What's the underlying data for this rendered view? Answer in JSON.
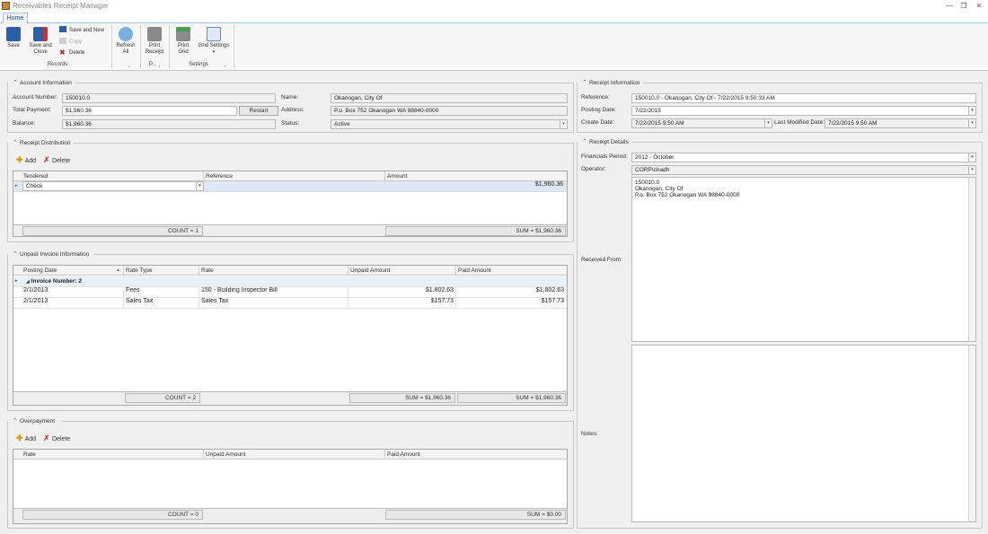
{
  "window": {
    "title": "Receivables Receipt Manager",
    "minimize": "—",
    "restore": "❐",
    "close": "✕"
  },
  "tabs": {
    "home": "Home"
  },
  "ribbon": {
    "save": "Save",
    "save_and_close_1": "Save and",
    "save_and_close_2": "Close",
    "save_and_new": "Save and New",
    "copy": "Copy",
    "delete": "Delete",
    "records_group": "Records",
    "refresh_1": "Refresh",
    "refresh_2": "All",
    "print_receipt_1": "Print",
    "print_receipt_2": "Receipt",
    "print_group": "P...",
    "print_grid_1": "Print",
    "print_grid_2": "Grid",
    "grid_settings": "Grid Settings",
    "settings_group": "Settings",
    "launcher": "⌟"
  },
  "account": {
    "section": "Account Information",
    "account_number_label": "Account Number:",
    "account_number": "150010.0",
    "total_payment_label": "Total Payment:",
    "total_payment": "$1,960.36",
    "restart": "Restart",
    "balance_label": "Balance:",
    "balance": "$1,960.36",
    "name_label": "Name:",
    "name": "Okanogan, City Of",
    "address_label": "Address:",
    "address": "P.o. Box 752 Okanogan WA 98840-0000",
    "status_label": "Status:",
    "status": "Active"
  },
  "distribution": {
    "section": "Receipt Distribution",
    "add": "Add",
    "delete": "Delete",
    "columns": [
      "Tendered",
      "Reference",
      "Amount"
    ],
    "rows": [
      {
        "tendered": "Check",
        "reference": "",
        "amount": "$1,960.36"
      }
    ],
    "count": "COUNT = 1",
    "sum": "SUM = $1,960.36"
  },
  "unpaid": {
    "section": "Unpaid Invoice Information",
    "columns": [
      "Posting Date",
      "Rate Type",
      "Rate",
      "Unpaid Amount",
      "Paid Amount"
    ],
    "group_label": "Invoice Number: 2",
    "rows": [
      {
        "posting_date": "2/1/2013",
        "rate_type": "Fees",
        "rate": "150 - Building Inspector Bill",
        "unpaid": "$1,802.63",
        "paid": "$1,802.63"
      },
      {
        "posting_date": "2/1/2013",
        "rate_type": "Sales Tax",
        "rate": "Sales Tax",
        "unpaid": "$157.73",
        "paid": "$157.73"
      }
    ],
    "count": "COUNT = 2",
    "sum_unpaid": "SUM = $1,960.36",
    "sum_paid": "SUM = $1,960.36"
  },
  "overpayment": {
    "section": "Overpayment",
    "add": "Add",
    "delete": "Delete",
    "columns": [
      "Rate",
      "Unpaid Amount",
      "Paid Amount"
    ],
    "count": "COUNT = 0",
    "sum": "SUM = $0.00"
  },
  "receipt_info": {
    "section": "Receipt Information",
    "reference_label": "Reference:",
    "reference": "150010.0 - Okanogan, City Of - 7/22/2015 9:50:33 AM",
    "posting_date_label": "Posting Date:",
    "posting_date": "7/22/2015",
    "create_date_label": "Create Date:",
    "create_date": "7/22/2015 9:50 AM",
    "last_modified_label": "Last Modified Date:",
    "last_modified": "7/22/2015 9:50 AM"
  },
  "receipt_details": {
    "section": "Receipt Details",
    "financials_period_label": "Financials Period:",
    "financials_period": "2012 - October",
    "operator_label": "Operator:",
    "operator": "CORP\\chadh",
    "received_from_label": "Received From:",
    "received_from_lines": [
      "150010.0",
      "Okanogan, City Of",
      "P.o. Box 752 Okanogan WA 98840-0000"
    ],
    "notes_label": "Notes:",
    "notes": ""
  },
  "colors": {
    "accent": "#1e4e8c",
    "selected_row": "#dde9f7",
    "group_row": "#e8f0fa"
  }
}
